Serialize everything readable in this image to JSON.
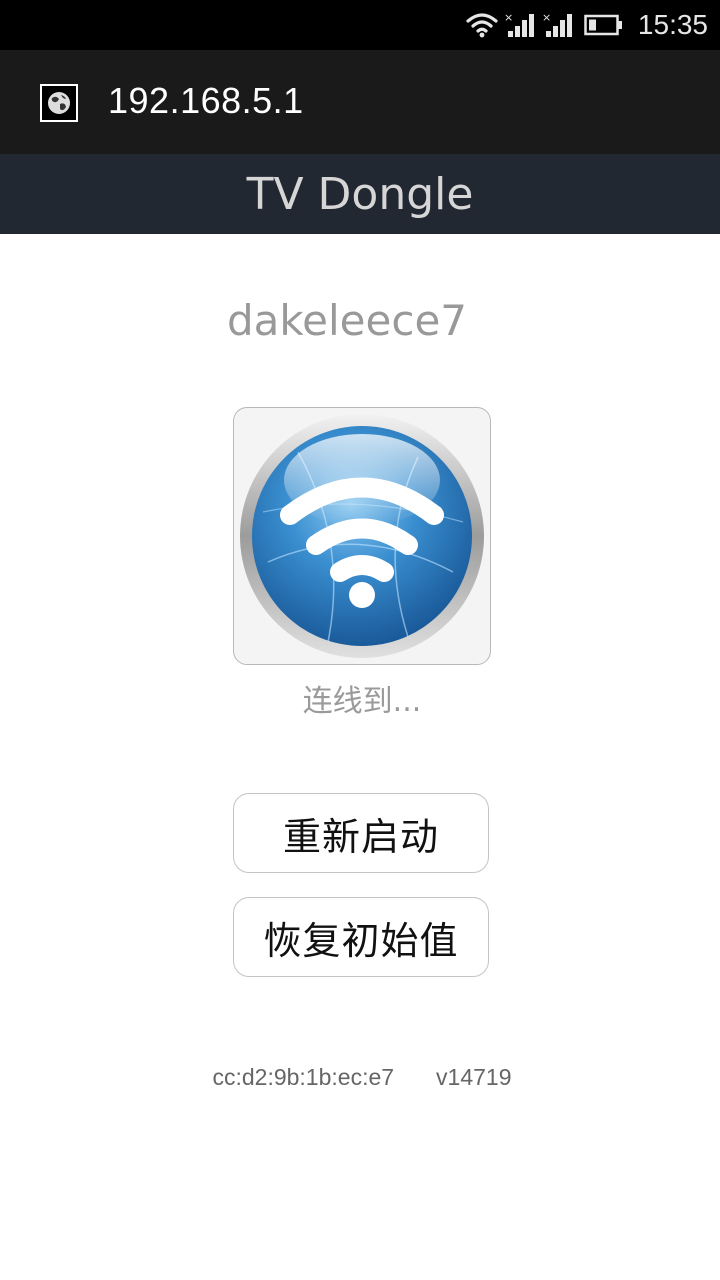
{
  "status_bar": {
    "time": "15:35",
    "icons": [
      "wifi-icon",
      "signal-icon",
      "signal-icon",
      "battery-icon"
    ]
  },
  "browser": {
    "url": "192.168.5.1",
    "favicon": "globe-icon"
  },
  "app": {
    "title": "TV Dongle"
  },
  "device": {
    "name": "dakeleece7",
    "connection_status": "连线到...",
    "status_icon": "wifi-icon"
  },
  "actions": {
    "restart_label": "重新启动",
    "factory_reset_label": "恢复初始值"
  },
  "footer": {
    "mac_address": "cc:d2:9b:1b:ec:e7",
    "version": "v14719"
  },
  "colors": {
    "status_bar_bg": "#000000",
    "url_bar_bg": "#1a1a1a",
    "title_bar_bg": "#212832",
    "accent_blue": "#3a8fd0"
  }
}
